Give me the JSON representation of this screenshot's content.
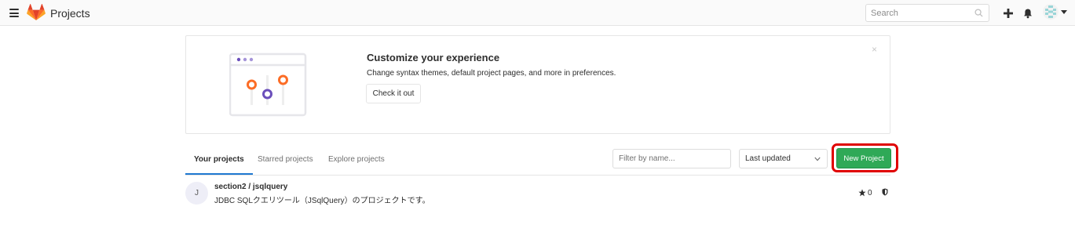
{
  "header": {
    "title": "Projects",
    "search_placeholder": "Search",
    "icons": [
      "hamburger-icon",
      "gitlab-logo",
      "search-icon",
      "plus-icon",
      "bell-icon",
      "avatar",
      "caret-down-icon"
    ]
  },
  "banner": {
    "title": "Customize your experience",
    "text": "Change syntax themes, default project pages, and more in preferences.",
    "button_label": "Check it out",
    "close_label": "×"
  },
  "tabs": [
    {
      "label": "Your projects",
      "active": true
    },
    {
      "label": "Starred projects",
      "active": false
    },
    {
      "label": "Explore projects",
      "active": false
    }
  ],
  "filter": {
    "placeholder": "Filter by name...",
    "sort_selected": "Last updated",
    "new_project_label": "New Project"
  },
  "projects": [
    {
      "avatar_letter": "J",
      "name": "section2 / jsqlquery",
      "description": "JDBC SQLクエリツール（JSqlQuery）のプロジェクトです。",
      "stars": "0"
    }
  ],
  "colors": {
    "accent_blue": "#1f78d1",
    "new_project_green": "#2fa957",
    "highlight_red": "#e00000",
    "gitlab_orange": "#fc6d26",
    "illustration_purple": "#6b4fbb"
  }
}
